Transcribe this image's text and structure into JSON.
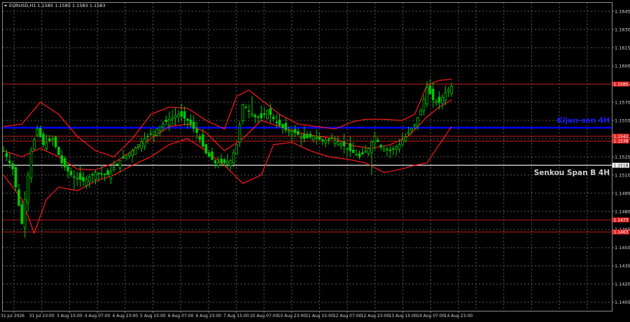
{
  "header": {
    "symbol_info": "EURUSD,H1  1.1585 1.1585 1.1583 1.1583"
  },
  "colors": {
    "background": "#000000",
    "grid": "#5a5a5a",
    "candle": "#00c800",
    "bollinger": "#ff1a1a",
    "resistance": "#b71c1c",
    "kijun": "#0000ff",
    "senkou": "#e8e8e8",
    "label_kijun": "#1a1aff",
    "label_senkou": "#d0d0d0"
  },
  "chart_data": {
    "type": "candlestick",
    "symbol": "EURUSD",
    "timeframe": "H1",
    "ylim": [
      1.1398,
      1.1652
    ],
    "price_ticks": [
      "1.1645",
      "1.1630",
      "1.1615",
      "1.1600",
      "1.1585",
      "1.1570",
      "1.1555",
      "1.1540",
      "1.1525",
      "1.1510",
      "1.1495",
      "1.1480",
      "1.1465",
      "1.1450",
      "1.1435",
      "1.1420",
      "1.1405"
    ],
    "time_ticks": [
      "31 Jul 2026",
      "31 Jul 23:00",
      "3 Aug 15:00",
      "4 Aug 07:00",
      "4 Aug 23:00",
      "5 Aug 15:00",
      "6 Aug 07:00",
      "6 Aug 23:00",
      "7 Aug 15:00",
      "10 Aug 07:00",
      "10 Aug 23:00",
      "11 Aug 15:00",
      "12 Aug 07:00",
      "12 Aug 23:00",
      "13 Aug 15:00",
      "14 Aug 07:00",
      "14 Aug 23:00"
    ],
    "current_price": 1.1583,
    "current_price_label": "1.1583",
    "levels": [
      {
        "price": 1.1585,
        "label": "1.1585",
        "kind": "resistance"
      },
      {
        "price": 1.1549,
        "label": "",
        "kind": "kijun",
        "text": "Kijun-sen 4H"
      },
      {
        "price": 1.1542,
        "label": "1.1542",
        "kind": "resistance"
      },
      {
        "price": 1.1538,
        "label": "1.1538",
        "kind": "resistance"
      },
      {
        "price": 1.1518,
        "label": "1.1518",
        "kind": "senkou",
        "text": "Senkou Span B 4H"
      },
      {
        "price": 1.1473,
        "label": "1.1473",
        "kind": "resistance"
      },
      {
        "price": 1.1463,
        "label": "1.1463",
        "kind": "resistance"
      }
    ],
    "path_points": [
      [
        0,
        1.153
      ],
      [
        3,
        1.1515
      ],
      [
        6,
        1.147
      ],
      [
        9,
        1.153
      ],
      [
        11,
        1.1548
      ],
      [
        13,
        1.1535
      ],
      [
        16,
        1.154
      ],
      [
        19,
        1.152
      ],
      [
        22,
        1.151
      ],
      [
        26,
        1.1505
      ],
      [
        30,
        1.1512
      ],
      [
        34,
        1.151
      ],
      [
        38,
        1.1522
      ],
      [
        42,
        1.153
      ],
      [
        46,
        1.154
      ],
      [
        50,
        1.1548
      ],
      [
        54,
        1.1556
      ],
      [
        57,
        1.156
      ],
      [
        60,
        1.1555
      ],
      [
        63,
        1.1545
      ],
      [
        66,
        1.1528
      ],
      [
        69,
        1.152
      ],
      [
        72,
        1.152
      ],
      [
        74,
        1.1522
      ],
      [
        76,
        1.1535
      ],
      [
        78,
        1.1568
      ],
      [
        80,
        1.1563
      ],
      [
        82,
        1.1558
      ],
      [
        84,
        1.1557
      ],
      [
        86,
        1.1563
      ],
      [
        89,
        1.1553
      ],
      [
        92,
        1.1547
      ],
      [
        95,
        1.1545
      ],
      [
        98,
        1.154
      ],
      [
        101,
        1.1542
      ],
      [
        104,
        1.1538
      ],
      [
        107,
        1.154
      ],
      [
        110,
        1.1536
      ],
      [
        113,
        1.153
      ],
      [
        116,
        1.1525
      ],
      [
        119,
        1.1532
      ],
      [
        121,
        1.1542
      ],
      [
        123,
        1.1533
      ],
      [
        126,
        1.153
      ],
      [
        129,
        1.1535
      ],
      [
        132,
        1.1545
      ],
      [
        134,
        1.1552
      ],
      [
        136,
        1.1563
      ],
      [
        138,
        1.1582
      ],
      [
        140,
        1.1572
      ],
      [
        142,
        1.157
      ],
      [
        144,
        1.1578
      ],
      [
        146,
        1.1583
      ]
    ],
    "bollinger_upper": [
      [
        0,
        1.155
      ],
      [
        6,
        1.1552
      ],
      [
        12,
        1.157
      ],
      [
        18,
        1.156
      ],
      [
        24,
        1.1542
      ],
      [
        30,
        1.153
      ],
      [
        36,
        1.1525
      ],
      [
        42,
        1.154
      ],
      [
        48,
        1.156
      ],
      [
        54,
        1.1566
      ],
      [
        60,
        1.1565
      ],
      [
        66,
        1.1555
      ],
      [
        72,
        1.1548
      ],
      [
        76,
        1.1575
      ],
      [
        80,
        1.158
      ],
      [
        84,
        1.1572
      ],
      [
        90,
        1.156
      ],
      [
        96,
        1.1552
      ],
      [
        102,
        1.155
      ],
      [
        108,
        1.1548
      ],
      [
        114,
        1.1554
      ],
      [
        118,
        1.1556
      ],
      [
        124,
        1.1556
      ],
      [
        130,
        1.1555
      ],
      [
        134,
        1.156
      ],
      [
        138,
        1.1584
      ],
      [
        142,
        1.1588
      ],
      [
        146,
        1.1589
      ]
    ],
    "bollinger_middle": [
      [
        0,
        1.153
      ],
      [
        6,
        1.1525
      ],
      [
        12,
        1.1532
      ],
      [
        18,
        1.1525
      ],
      [
        24,
        1.1515
      ],
      [
        30,
        1.1514
      ],
      [
        36,
        1.152
      ],
      [
        42,
        1.153
      ],
      [
        48,
        1.154
      ],
      [
        54,
        1.155
      ],
      [
        60,
        1.1552
      ],
      [
        66,
        1.1545
      ],
      [
        72,
        1.153
      ],
      [
        78,
        1.154
      ],
      [
        84,
        1.1555
      ],
      [
        90,
        1.155
      ],
      [
        96,
        1.1545
      ],
      [
        102,
        1.1542
      ],
      [
        108,
        1.154
      ],
      [
        114,
        1.1534
      ],
      [
        120,
        1.1532
      ],
      [
        126,
        1.1535
      ],
      [
        132,
        1.1542
      ],
      [
        138,
        1.1558
      ],
      [
        142,
        1.1566
      ],
      [
        146,
        1.1572
      ]
    ],
    "bollinger_lower": [
      [
        0,
        1.151
      ],
      [
        6,
        1.149
      ],
      [
        10,
        1.1462
      ],
      [
        14,
        1.149
      ],
      [
        18,
        1.15
      ],
      [
        24,
        1.1497
      ],
      [
        30,
        1.1505
      ],
      [
        36,
        1.151
      ],
      [
        42,
        1.1518
      ],
      [
        48,
        1.1525
      ],
      [
        54,
        1.1535
      ],
      [
        60,
        1.154
      ],
      [
        66,
        1.153
      ],
      [
        72,
        1.1518
      ],
      [
        78,
        1.1503
      ],
      [
        84,
        1.151
      ],
      [
        88,
        1.1535
      ],
      [
        94,
        1.1537
      ],
      [
        100,
        1.153
      ],
      [
        106,
        1.1525
      ],
      [
        112,
        1.1523
      ],
      [
        118,
        1.152
      ],
      [
        124,
        1.1512
      ],
      [
        130,
        1.1515
      ],
      [
        134,
        1.1518
      ],
      [
        138,
        1.152
      ],
      [
        142,
        1.1535
      ],
      [
        146,
        1.155
      ]
    ],
    "bars_count": 147
  }
}
